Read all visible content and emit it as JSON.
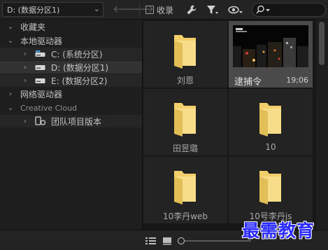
{
  "toolbar": {
    "volume_selected": "D: (数据分区1)",
    "back_icon": "arrow-left-icon",
    "forward_icon": "arrow-right-icon",
    "collect_label": "收录",
    "settings_icon": "wrench-icon",
    "filter_icon": "filter-icon",
    "view_icon": "eye-icon",
    "search_icon": "search-icon"
  },
  "tree": {
    "favorites": "收藏夹",
    "local_drives": "本地驱动器",
    "drives": [
      {
        "label": "C: (系统分区)"
      },
      {
        "label": "D: (数据分区1)"
      },
      {
        "label": "E: (数据分区2)"
      }
    ],
    "network_drives": "网络驱动器",
    "creative_cloud": "Creative Cloud",
    "team_projects": "团队项目版本"
  },
  "grid": {
    "items": [
      {
        "name": "刘恩",
        "type": "folder"
      },
      {
        "name": "逮捕令",
        "type": "clip",
        "duration": "19;06"
      },
      {
        "name": "田昱璐",
        "type": "folder"
      },
      {
        "name": "10",
        "type": "folder"
      },
      {
        "name": "10李丹web",
        "type": "folder"
      },
      {
        "name": "10号李丹js",
        "type": "folder"
      }
    ]
  },
  "bottom": {
    "list_view_icon": "list-view-icon",
    "icon_view_icon": "icon-view-icon",
    "zoom_slider": "zoom-slider"
  },
  "watermark": "最需教育",
  "colors": {
    "background": "#1d1d1d",
    "folder": "#f2cf6b",
    "watermark": "#2b2bff"
  }
}
